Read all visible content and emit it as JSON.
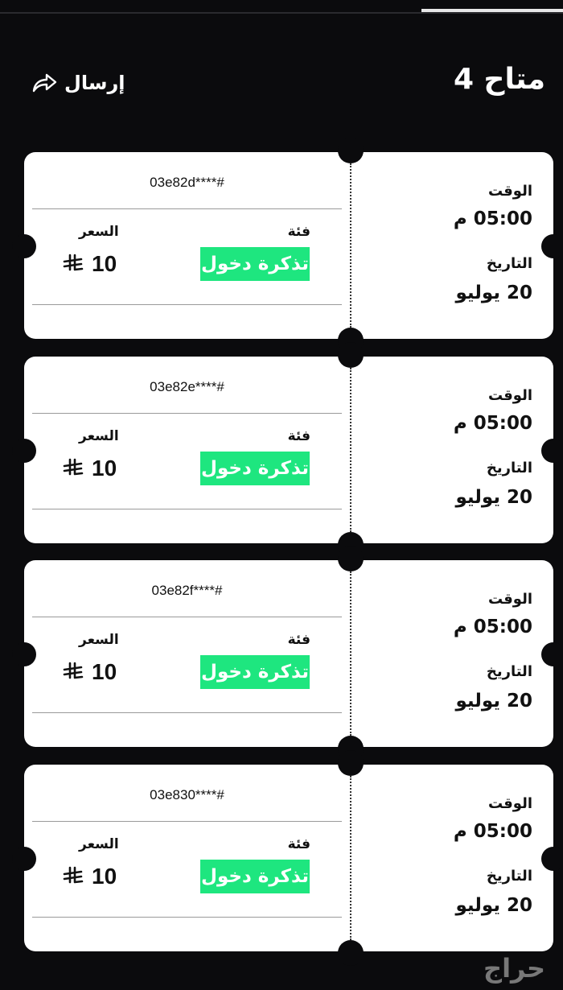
{
  "header": {
    "title": "متاح 4",
    "send_label": "إرسال"
  },
  "tickets": [
    {
      "code": "03e82d****#",
      "category_label": "فئة",
      "category": "تذكرة دخول",
      "price_label": "السعر",
      "price": "10",
      "time_label": "الوقت",
      "time": "05:00 م",
      "date_label": "التاريخ",
      "date": "20 يوليو"
    },
    {
      "code": "03e82e****#",
      "category_label": "فئة",
      "category": "تذكرة دخول",
      "price_label": "السعر",
      "price": "10",
      "time_label": "الوقت",
      "time": "05:00 م",
      "date_label": "التاريخ",
      "date": "20 يوليو"
    },
    {
      "code": "03e82f****#",
      "category_label": "فئة",
      "category": "تذكرة دخول",
      "price_label": "السعر",
      "price": "10",
      "time_label": "الوقت",
      "time": "05:00 م",
      "date_label": "التاريخ",
      "date": "20 يوليو"
    },
    {
      "code": "03e830****#",
      "category_label": "فئة",
      "category": "تذكرة دخول",
      "price_label": "السعر",
      "price": "10",
      "time_label": "الوقت",
      "time": "05:00 م",
      "date_label": "التاريخ",
      "date": "20 يوليو"
    }
  ],
  "icons": {
    "send": "share-arrow-icon",
    "currency": "riyal-currency-icon"
  },
  "colors": {
    "background": "#0b0b0d",
    "badge": "#1ee67f"
  },
  "watermark": "حراج"
}
